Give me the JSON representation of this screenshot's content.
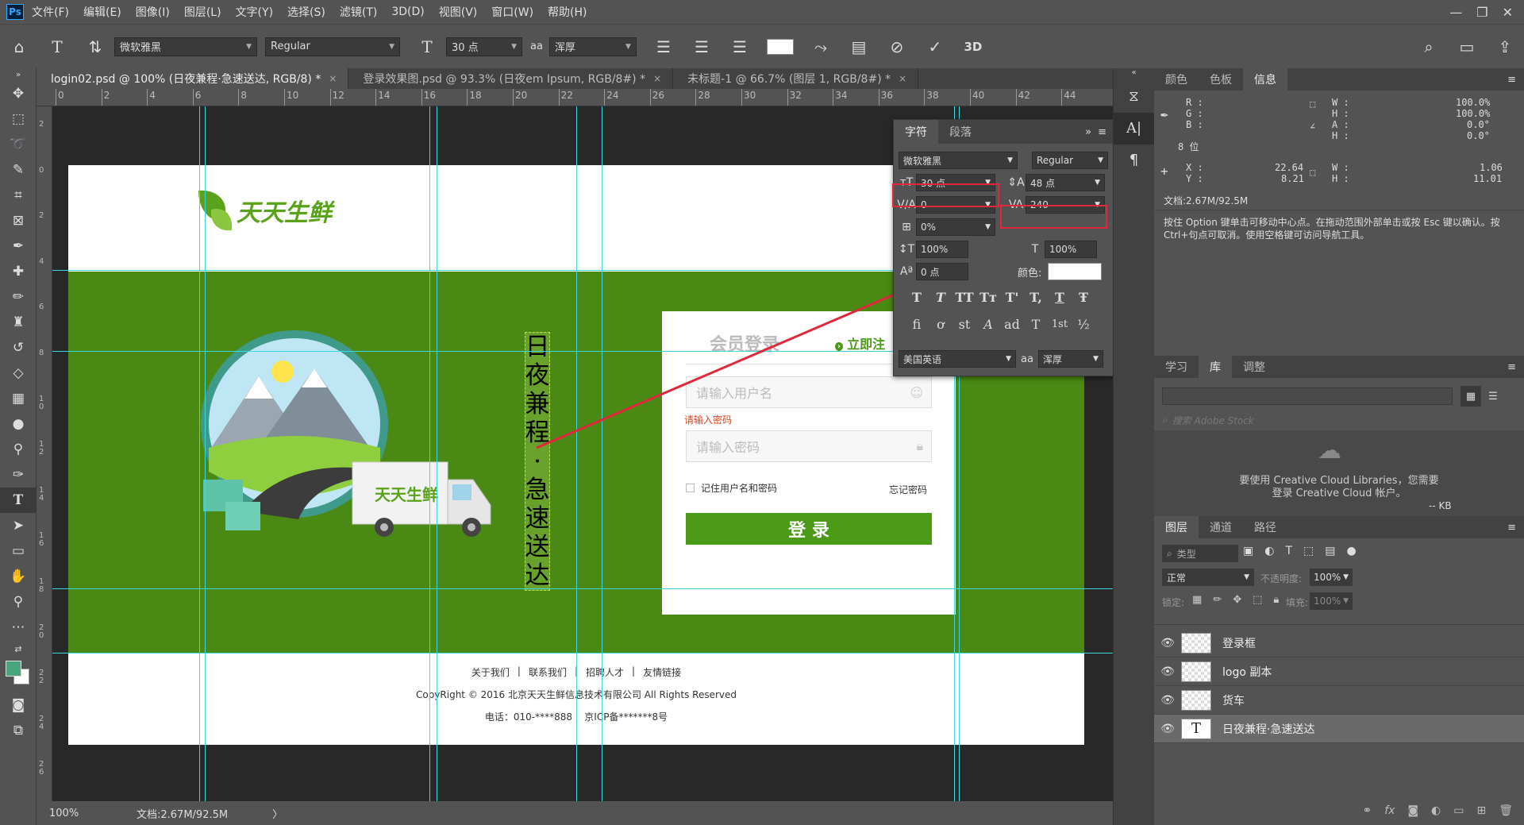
{
  "app": {
    "logo": "Ps"
  },
  "menu": [
    "文件(F)",
    "编辑(E)",
    "图像(I)",
    "图层(L)",
    "文字(Y)",
    "选择(S)",
    "滤镜(T)",
    "3D(D)",
    "视图(V)",
    "窗口(W)",
    "帮助(H)"
  ],
  "options": {
    "font_family": "微软雅黑",
    "font_style": "Regular",
    "font_size": "30 点",
    "aa_label": "aa",
    "antialias": "浑厚",
    "label_3d": "3D"
  },
  "doc_tabs": [
    {
      "label": "login02.psd @ 100% (日夜兼程·急速送达, RGB/8) *",
      "close": "×"
    },
    {
      "label": "登录效果图.psd @ 93.3% (日夜em Ipsum, RGB/8#) *",
      "close": "×"
    },
    {
      "label": "未标题-1 @ 66.7% (图层 1, RGB/8#) *",
      "close": "×"
    }
  ],
  "ruler_top": [
    "0",
    "2",
    "4",
    "6",
    "8",
    "10",
    "12",
    "14",
    "16",
    "18",
    "20",
    "22",
    "24",
    "26",
    "28",
    "30",
    "32",
    "34",
    "36",
    "38",
    "40",
    "42",
    "44"
  ],
  "ruler_left": [
    "2",
    "0",
    "2",
    "4",
    "6",
    "8",
    "1 0",
    "1 2",
    "1 4",
    "1 6",
    "1 8",
    "2 0",
    "2 2",
    "2 4",
    "2 6"
  ],
  "canvas": {
    "logo_text": "天天生鲜",
    "truck_text": "天天生鲜",
    "vertical_text": [
      "日",
      "夜",
      "兼",
      "程",
      "·",
      "急",
      "速",
      "送",
      "达"
    ],
    "login": {
      "title": "会员登录",
      "register": "立即注",
      "username_ph": "请输入用户名",
      "password_err": "请输入密码",
      "password_ph": "请输入密码",
      "remember": "记住用户名和密码",
      "forgot": "忘记密码",
      "submit": "登 录"
    },
    "footer": {
      "links": [
        "关于我们",
        "|",
        "联系我们",
        "|",
        "招聘人才",
        "|",
        "友情链接"
      ],
      "copyright": "CopyRight © 2016 北京天天生鲜信息技术有限公司 All Rights Reserved",
      "phone": "电话：010-****888    京ICP备*******8号"
    }
  },
  "status": {
    "zoom": "100%",
    "doc": "文档:2.67M/92.5M",
    "arrow": "〉"
  },
  "char_panel": {
    "tabs": [
      "字符",
      "段落"
    ],
    "menu": "»",
    "font": "微软雅黑",
    "style": "Regular",
    "size": "30 点",
    "leading": "48 点",
    "kerning": "0",
    "tracking": "240",
    "vscale_pct": "0%",
    "vertical_scale": "100%",
    "horizontal_scale": "100%",
    "baseline": "0 点",
    "color_label": "颜色:",
    "style_glyphs": [
      "T",
      "T",
      "TT",
      "Tт",
      "T'",
      "T,",
      "T",
      "Ŧ"
    ],
    "ot_glyphs": [
      "fi",
      "ơ",
      "st",
      "A",
      "ad",
      "T",
      "1st",
      "½"
    ],
    "language": "美国英语",
    "aa_label": "aa",
    "antialias": "浑厚"
  },
  "right": {
    "top_tabs": [
      "颜色",
      "色板",
      "信息"
    ],
    "info": {
      "r": "R :",
      "g": "G :",
      "b": "B :",
      "bit": "8 位",
      "w_label": "W :",
      "h_label": "H :",
      "a_label": "A :",
      "h2_label": "H :",
      "w_pct": "100.0%",
      "h_pct": "100.0%",
      "a_val": "0.0°",
      "h_val": "0.0°",
      "x_label": "X :",
      "y_label": "Y :",
      "x": "22.64",
      "y": "8.21",
      "w2_label": "W :",
      "h3_label": "H :",
      "w2": "1.06",
      "h3": "11.01",
      "doc": "文档:2.67M/92.5M",
      "hint": "按住 Option 键单击可移动中心点。在拖动范围外部单击或按 Esc 键以确认。按 Ctrl+句点可取消。使用空格键可访问导航工具。"
    },
    "mid_tabs": [
      "学习",
      "库",
      "调整"
    ],
    "lib": {
      "search_ph": "搜索 Adobe Stock",
      "msg1": "要使用 Creative Cloud Libraries，您需要",
      "msg2": "登录 Creative Cloud 帐户。",
      "kb": "-- KB"
    },
    "layer_tabs": [
      "图层",
      "通道",
      "路径"
    ],
    "layers_ctrl": {
      "kind": "类型",
      "blend": "正常",
      "opacity_label": "不透明度:",
      "opacity": "100%",
      "lock_label": "锁定:",
      "fill_label": "填充:",
      "fill": "100%"
    },
    "layers": [
      {
        "name": "登录框"
      },
      {
        "name": "logo 副本"
      },
      {
        "name": "货车"
      },
      {
        "name": "日夜兼程·急速送达",
        "type": "T"
      }
    ]
  }
}
